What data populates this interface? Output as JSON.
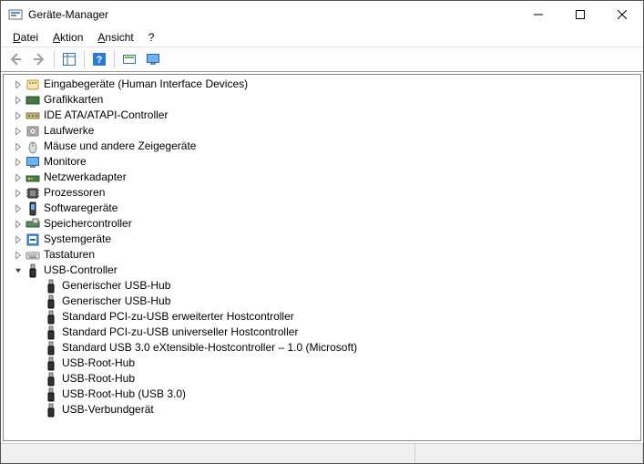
{
  "window": {
    "title": "Geräte-Manager"
  },
  "menu": {
    "file": "Datei",
    "action": "Aktion",
    "view": "Ansicht",
    "help": "?"
  },
  "tree": [
    {
      "level": 1,
      "expandable": true,
      "expanded": false,
      "icon": "hid",
      "label": "Eingabegeräte (Human Interface Devices)"
    },
    {
      "level": 1,
      "expandable": true,
      "expanded": false,
      "icon": "display-adapter",
      "label": "Grafikkarten"
    },
    {
      "level": 1,
      "expandable": true,
      "expanded": false,
      "icon": "ide",
      "label": "IDE ATA/ATAPI-Controller"
    },
    {
      "level": 1,
      "expandable": true,
      "expanded": false,
      "icon": "disk",
      "label": "Laufwerke"
    },
    {
      "level": 1,
      "expandable": true,
      "expanded": false,
      "icon": "mouse",
      "label": "Mäuse und andere Zeigegeräte"
    },
    {
      "level": 1,
      "expandable": true,
      "expanded": false,
      "icon": "monitor",
      "label": "Monitore"
    },
    {
      "level": 1,
      "expandable": true,
      "expanded": false,
      "icon": "network",
      "label": "Netzwerkadapter"
    },
    {
      "level": 1,
      "expandable": true,
      "expanded": false,
      "icon": "cpu",
      "label": "Prozessoren"
    },
    {
      "level": 1,
      "expandable": true,
      "expanded": false,
      "icon": "software",
      "label": "Softwaregeräte"
    },
    {
      "level": 1,
      "expandable": true,
      "expanded": false,
      "icon": "storage",
      "label": "Speichercontroller"
    },
    {
      "level": 1,
      "expandable": true,
      "expanded": false,
      "icon": "system",
      "label": "Systemgeräte"
    },
    {
      "level": 1,
      "expandable": true,
      "expanded": false,
      "icon": "keyboard",
      "label": "Tastaturen"
    },
    {
      "level": 1,
      "expandable": true,
      "expanded": true,
      "icon": "usb",
      "label": "USB-Controller"
    },
    {
      "level": 2,
      "expandable": false,
      "icon": "usb",
      "label": "Generischer USB-Hub"
    },
    {
      "level": 2,
      "expandable": false,
      "icon": "usb",
      "label": "Generischer USB-Hub"
    },
    {
      "level": 2,
      "expandable": false,
      "icon": "usb",
      "label": "Standard PCI-zu-USB erweiterter Hostcontroller"
    },
    {
      "level": 2,
      "expandable": false,
      "icon": "usb",
      "label": "Standard PCI-zu-USB universeller Hostcontroller"
    },
    {
      "level": 2,
      "expandable": false,
      "icon": "usb",
      "label": "Standard USB 3.0 eXtensible-Hostcontroller – 1.0 (Microsoft)"
    },
    {
      "level": 2,
      "expandable": false,
      "icon": "usb",
      "label": "USB-Root-Hub"
    },
    {
      "level": 2,
      "expandable": false,
      "icon": "usb",
      "label": "USB-Root-Hub"
    },
    {
      "level": 2,
      "expandable": false,
      "icon": "usb",
      "label": "USB-Root-Hub (USB 3.0)"
    },
    {
      "level": 2,
      "expandable": false,
      "icon": "usb",
      "label": "USB-Verbundgerät"
    }
  ]
}
